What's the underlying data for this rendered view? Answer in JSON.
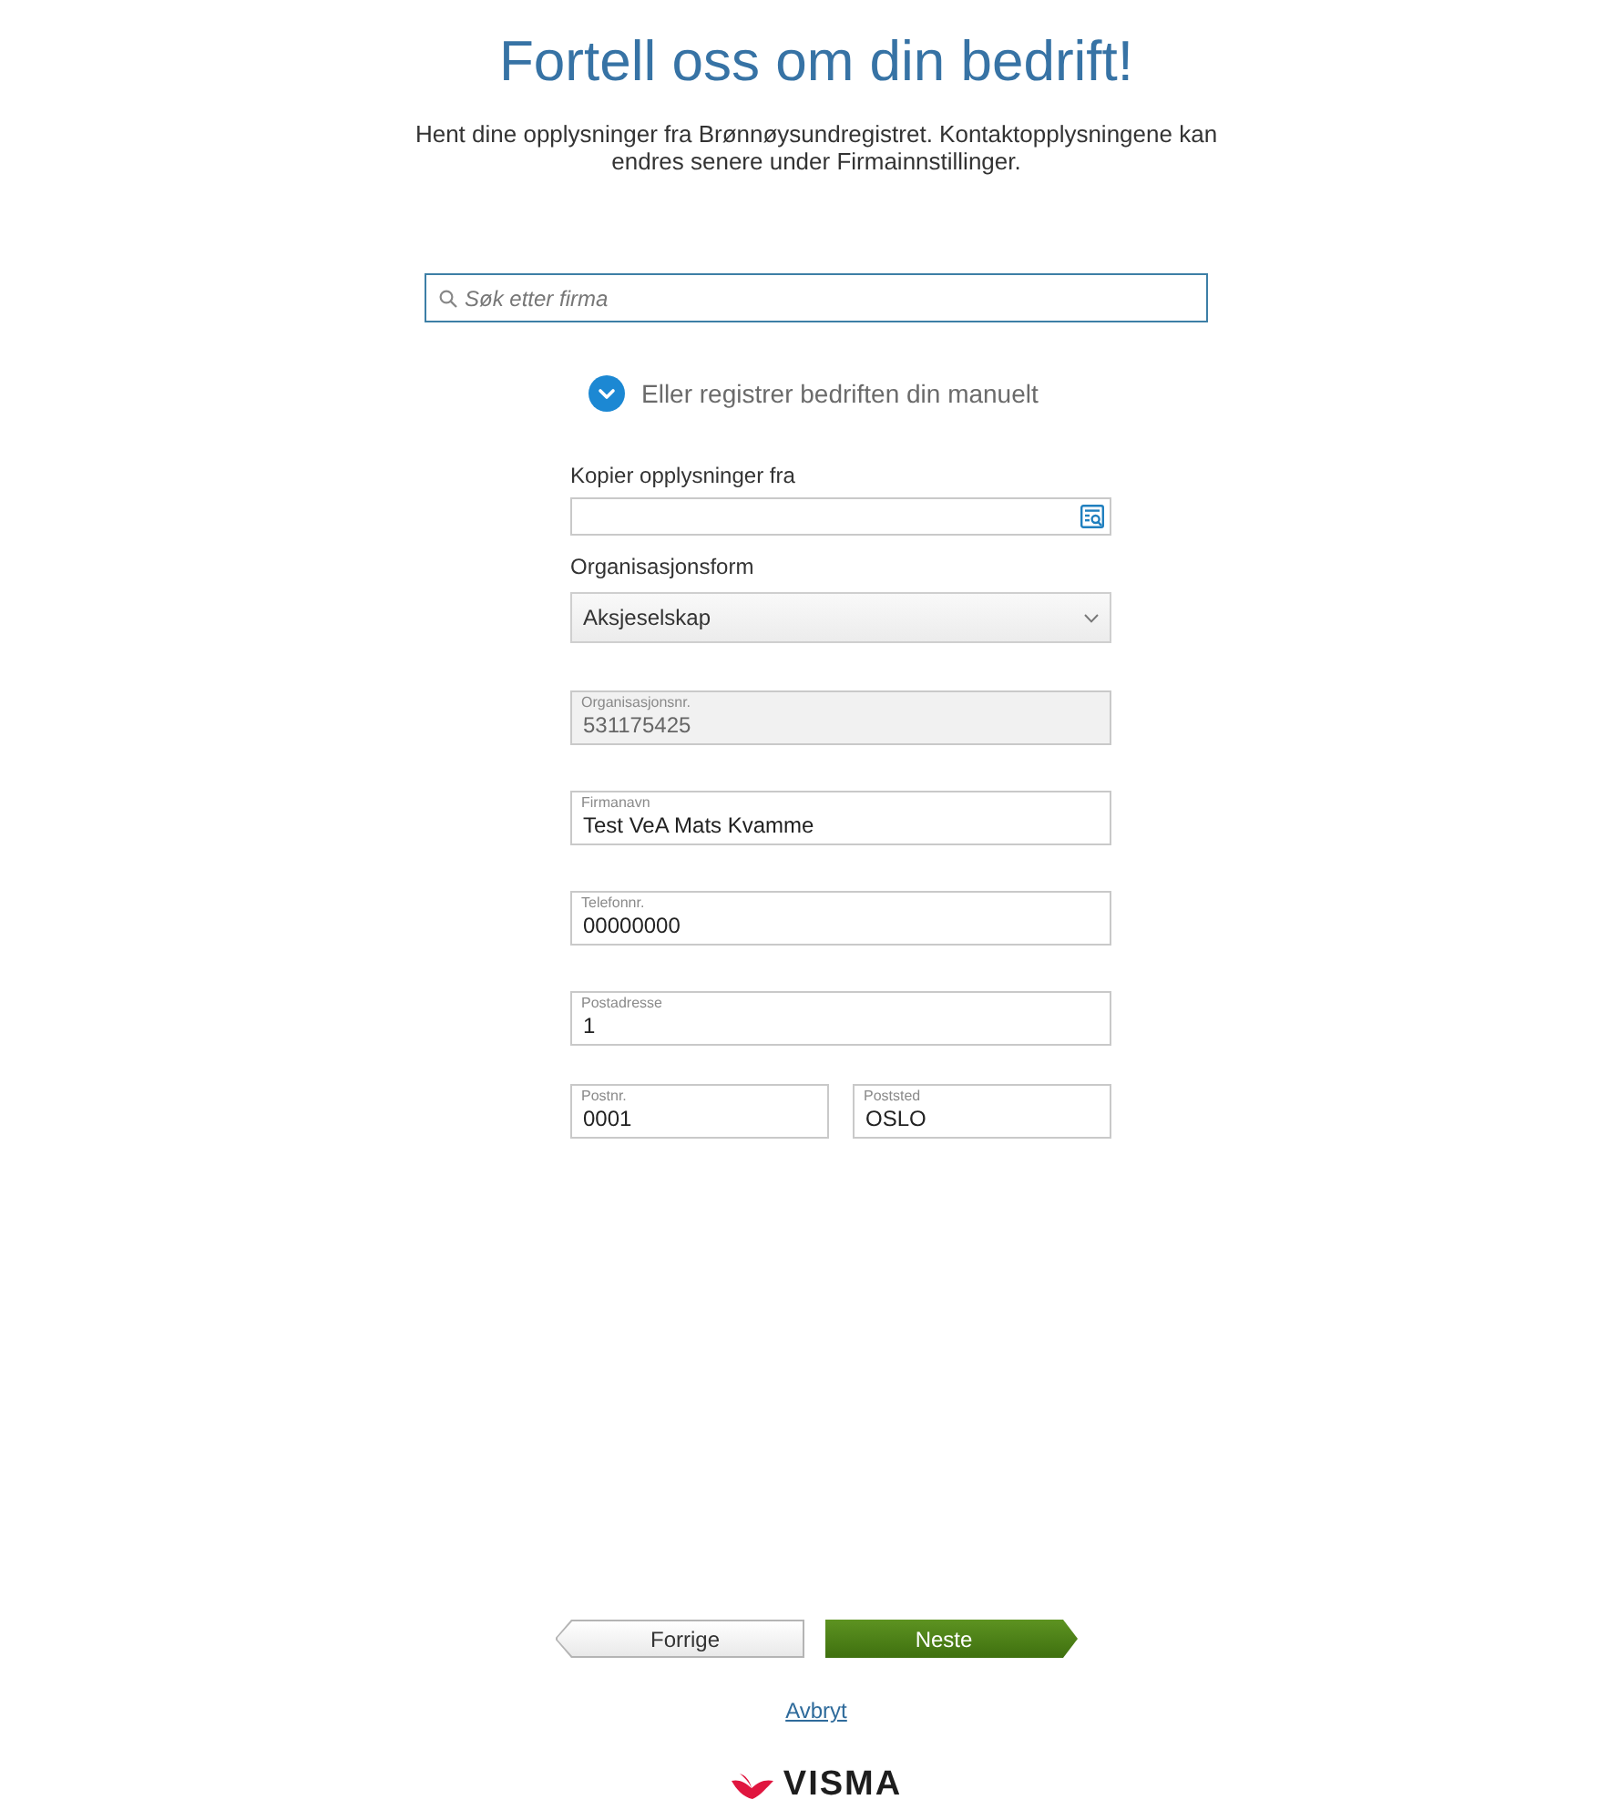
{
  "header": {
    "title": "Fortell oss om din bedrift!",
    "intro": "Hent dine opplysninger fra Brønnøysundregistret. Kontaktopplysningene kan endres senere under Firmainnstillinger."
  },
  "search": {
    "placeholder": "Søk etter firma"
  },
  "manual_toggle": {
    "label": "Eller registrer bedriften din manuelt",
    "expanded": true
  },
  "form": {
    "rows": [
      [
        {
          "kind": "lookup",
          "label": "Kopier opplysninger fra"
        }
      ],
      [
        {
          "kind": "select",
          "label": "Organisasjonsform",
          "value": "Aksjeselskap"
        }
      ],
      [
        {
          "kind": "floating",
          "label": "Organisasjonsnr.",
          "value": "531175425",
          "disabled": true
        }
      ],
      [
        {
          "kind": "floating",
          "label": "Firmanavn",
          "value": "Test VeA Mats Kvamme",
          "disabled": false
        }
      ],
      [
        {
          "kind": "floating",
          "label": "Telefonnr.",
          "value": "00000000",
          "disabled": false
        }
      ],
      [
        {
          "kind": "floating",
          "label": "Postadresse",
          "value": "1",
          "disabled": false
        }
      ],
      [
        {
          "kind": "floating",
          "label": "Postnr.",
          "value": "0001",
          "disabled": false
        },
        {
          "kind": "floating",
          "label": "Poststed",
          "value": "OSLO",
          "disabled": false
        }
      ]
    ]
  },
  "nav_buttons": [
    {
      "kind": "back",
      "label": "Forrige"
    },
    {
      "kind": "next",
      "label": "Neste"
    }
  ],
  "cancel_link": {
    "label": "Avbryt"
  },
  "logo": {
    "text": "VISMA"
  }
}
